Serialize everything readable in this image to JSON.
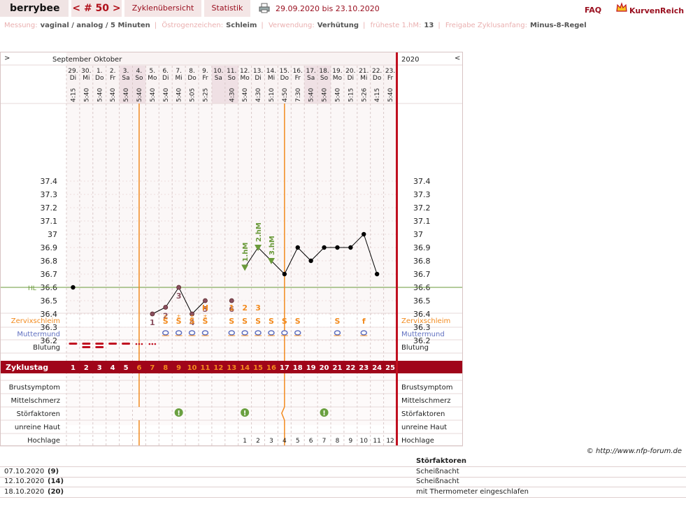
{
  "header": {
    "user": "berrybee",
    "cycle_nav": "< # 50 >",
    "tab_overview": "Zyklenübersicht",
    "tab_stats": "Statistik",
    "date_range": "29.09.2020 bis 23.10.2020",
    "faq": "FAQ",
    "brand": "KurvenReich"
  },
  "info": [
    {
      "label": "Messung:",
      "value": "vaginal / analog / 5 Minuten"
    },
    {
      "label": "Östrogenzeichen:",
      "value": "Schleim"
    },
    {
      "label": "Verwendung:",
      "value": "Verhütung"
    },
    {
      "label": "früheste 1.hM:",
      "value": "13"
    },
    {
      "label": "Freigabe Zyklusanfang:",
      "value": "Minus-8-Regel"
    }
  ],
  "chart_data": {
    "type": "line",
    "year": "2020",
    "months": [
      "September",
      "Oktober"
    ],
    "nav_left": ">",
    "nav_right": "<",
    "dates": [
      "29.",
      "30.",
      "1.",
      "2.",
      "3.",
      "4.",
      "5.",
      "6.",
      "7.",
      "8.",
      "9.",
      "10.",
      "11.",
      "12.",
      "13.",
      "14.",
      "15.",
      "16.",
      "17.",
      "18.",
      "19.",
      "20.",
      "21.",
      "22.",
      "23."
    ],
    "weekdays": [
      "Di",
      "Mi",
      "Do",
      "Fr",
      "Sa",
      "So",
      "Mo",
      "Di",
      "Mi",
      "Do",
      "Fr",
      "Sa",
      "So",
      "Mo",
      "Di",
      "Mi",
      "Do",
      "Fr",
      "Sa",
      "So",
      "Mo",
      "Di",
      "Mi",
      "Do",
      "Fr"
    ],
    "times": [
      "4:15",
      "5:40",
      "5:40",
      "5:40",
      "5:40",
      "5:40",
      "5:40",
      "5:40",
      "5:40",
      "5:05",
      "5:25",
      "",
      "4:30",
      "5:40",
      "4:30",
      "5:10",
      "4:50",
      "7:30",
      "5:40",
      "5:40",
      "5:40",
      "5:15",
      "5:26",
      "4:15",
      "5:40"
    ],
    "weekend_days": [
      5,
      6,
      12,
      13,
      19,
      20
    ],
    "y_ticks": [
      37.4,
      37.3,
      37.2,
      37.1,
      37,
      36.9,
      36.8,
      36.7,
      36.6,
      36.5,
      36.4,
      36.3,
      36.2
    ],
    "ylim": [
      36.1,
      37.5
    ],
    "hl_label": "HL",
    "hl_value": 36.6,
    "temps": [
      {
        "day": 1,
        "value": 36.6
      },
      {
        "day": 7,
        "value": 36.4
      },
      {
        "day": 8,
        "value": 36.45
      },
      {
        "day": 9,
        "value": 36.6
      },
      {
        "day": 10,
        "value": 36.4
      },
      {
        "day": 11,
        "value": 36.5
      },
      {
        "day": 13,
        "value": 36.5
      },
      {
        "day": 14,
        "value": 36.75
      },
      {
        "day": 15,
        "value": 36.9
      },
      {
        "day": 16,
        "value": 36.8
      },
      {
        "day": 17,
        "value": 36.7
      },
      {
        "day": 18,
        "value": 36.9
      },
      {
        "day": 19,
        "value": 36.8
      },
      {
        "day": 20,
        "value": 36.9
      },
      {
        "day": 21,
        "value": 36.9
      },
      {
        "day": 22,
        "value": 36.9
      },
      {
        "day": 23,
        "value": 37
      },
      {
        "day": 24,
        "value": 36.7
      }
    ],
    "segments": [
      [
        7,
        8,
        9,
        10,
        11
      ],
      [
        14,
        15,
        16,
        17,
        18,
        19,
        20,
        21,
        22,
        23,
        24
      ]
    ],
    "low_labels": [
      {
        "day": 7,
        "text": "1"
      },
      {
        "day": 8,
        "text": "2"
      },
      {
        "day": 9,
        "text": "3"
      },
      {
        "day": 10,
        "text": "4"
      },
      {
        "day": 11,
        "text": "5"
      },
      {
        "day": 13,
        "text": "6"
      }
    ],
    "high_marks": [
      {
        "day": 14,
        "text": "1.hM"
      },
      {
        "day": 15,
        "text": "2.hM"
      },
      {
        "day": 16,
        "text": "3.hM"
      }
    ],
    "orange_lines": [
      5.5,
      16.5
    ],
    "mucus_top": [
      {
        "day": 11,
        "text": "H"
      },
      {
        "day": 13,
        "text": "1"
      },
      {
        "day": 14,
        "text": "2"
      },
      {
        "day": 15,
        "text": "3"
      }
    ],
    "mucus": [
      {
        "day": 8,
        "text": "S"
      },
      {
        "day": 9,
        "text": "S"
      },
      {
        "day": 10,
        "text": "S"
      },
      {
        "day": 11,
        "text": "S"
      },
      {
        "day": 13,
        "text": "S"
      },
      {
        "day": 14,
        "text": "S"
      },
      {
        "day": 15,
        "text": "S"
      },
      {
        "day": 16,
        "text": "S"
      },
      {
        "day": 17,
        "text": "S"
      },
      {
        "day": 18,
        "text": "S"
      },
      {
        "day": 21,
        "text": "S"
      },
      {
        "day": 23,
        "text": "f"
      }
    ],
    "cervix_days": [
      8,
      9,
      10,
      11,
      13,
      14,
      15,
      16,
      17,
      18,
      21,
      23
    ],
    "bleeding": [
      {
        "day": 1,
        "level": "strong"
      },
      {
        "day": 2,
        "level": "heavy"
      },
      {
        "day": 3,
        "level": "heavy"
      },
      {
        "day": 4,
        "level": "strong"
      },
      {
        "day": 5,
        "level": "strong"
      },
      {
        "day": 6,
        "level": "spot"
      },
      {
        "day": 7,
        "level": "spot"
      }
    ],
    "row_labels": {
      "mucus": "Zervixschleim",
      "cervix": "Muttermund",
      "bleeding": "Blutung",
      "cycle": "Zyklustag",
      "breast": "Brustsymptom",
      "mittel": "Mittelschmerz",
      "stoer": "Störfaktoren",
      "skin": "unreine Haut",
      "hoch": "Hochlage"
    },
    "cycle_days": [
      "1",
      "2",
      "3",
      "4",
      "5",
      "6",
      "7",
      "8",
      "9",
      "10",
      "11",
      "12",
      "13",
      "14",
      "15",
      "16",
      "17",
      "18",
      "19",
      "20",
      "21",
      "22",
      "23",
      "24",
      "25"
    ],
    "stoer_days": [
      9,
      14,
      20
    ],
    "hochlage": [
      {
        "day": 14,
        "text": "1"
      },
      {
        "day": 15,
        "text": "2"
      },
      {
        "day": 16,
        "text": "3"
      },
      {
        "day": 17,
        "text": "4"
      },
      {
        "day": 18,
        "text": "5"
      },
      {
        "day": 19,
        "text": "6"
      },
      {
        "day": 20,
        "text": "7"
      },
      {
        "day": 21,
        "text": "8"
      },
      {
        "day": 22,
        "text": "9"
      },
      {
        "day": 23,
        "text": "10"
      },
      {
        "day": 24,
        "text": "11"
      },
      {
        "day": 25,
        "text": "12"
      }
    ],
    "colors": {
      "accent": "#a0051a",
      "orange": "#f28a1e",
      "green": "#6a9a3a",
      "temp_low": "#8a5060",
      "purple": "#6070c0"
    }
  },
  "footer": {
    "copyright": "© http://www.nfp-forum.de",
    "stoer_title": "Störfaktoren",
    "rows": [
      {
        "date": "07.10.2020",
        "day": "(9)",
        "text": "Scheißnacht"
      },
      {
        "date": "12.10.2020",
        "day": "(14)",
        "text": "Scheißnacht"
      },
      {
        "date": "18.10.2020",
        "day": "(20)",
        "text": "mit Thermometer eingeschlafen"
      }
    ]
  }
}
